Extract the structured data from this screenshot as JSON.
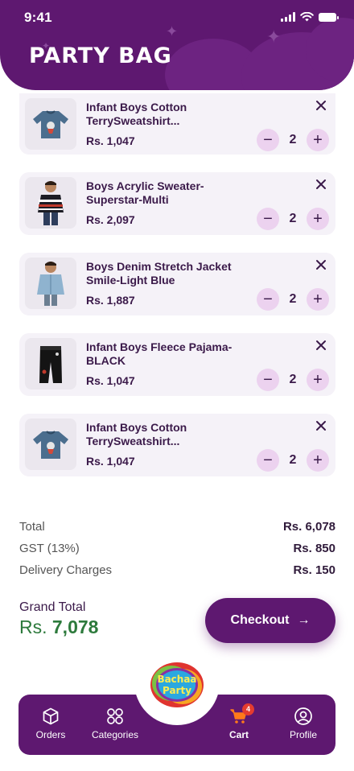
{
  "status_bar": {
    "time": "9:41"
  },
  "header": {
    "title": "PARTY BAG"
  },
  "cart": {
    "items": [
      {
        "name": "Infant Boys Cotton TerrySweatshirt...",
        "price": "Rs. 1,047",
        "quantity": "2",
        "image": "blue-sweatshirt"
      },
      {
        "name": "Boys Acrylic Sweater-Superstar-Multi",
        "price": "Rs. 2,097",
        "quantity": "2",
        "image": "striped-sweater"
      },
      {
        "name": "Boys Denim Stretch Jacket Smile-Light Blue",
        "price": "Rs. 1,887",
        "quantity": "2",
        "image": "denim-jacket"
      },
      {
        "name": "Infant Boys Fleece Pajama-BLACK",
        "price": "Rs. 1,047",
        "quantity": "2",
        "image": "black-pajama"
      },
      {
        "name": "Infant Boys Cotton TerrySweatshirt...",
        "price": "Rs. 1,047",
        "quantity": "2",
        "image": "blue-sweatshirt"
      }
    ],
    "minus_symbol": "−",
    "plus_symbol": "+"
  },
  "summary": {
    "total_label": "Total",
    "total_value": "Rs. 6,078",
    "gst_label": "GST (13%)",
    "gst_value": "Rs. 850",
    "delivery_label": "Delivery Charges",
    "delivery_value": "Rs. 150"
  },
  "grand_total": {
    "label": "Grand Total",
    "currency": "Rs.",
    "amount": "7,078"
  },
  "checkout": {
    "label": "Checkout",
    "arrow": "→"
  },
  "nav": {
    "orders": "Orders",
    "categories": "Categories",
    "cart": "Cart",
    "cart_badge": "4",
    "profile": "Profile",
    "active": "cart"
  },
  "logo": {
    "text_line1": "Bachaa",
    "text_line2": "Party"
  },
  "colors": {
    "brand": "#5e1870",
    "qty_button": "#ecd2ef",
    "card_bg": "#f5f2f8",
    "grand_total": "#2d7a3c",
    "badge": "#e43c2f"
  }
}
